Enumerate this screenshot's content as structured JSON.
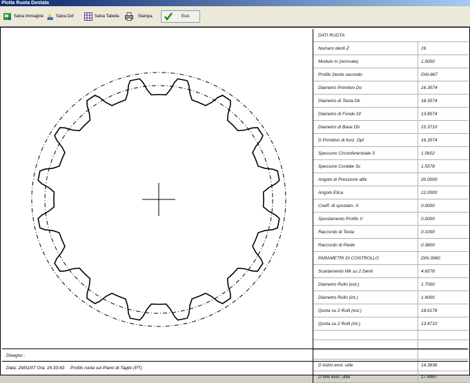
{
  "window": {
    "title": "Plotta Ruota Dentata"
  },
  "toolbar": {
    "buttons": [
      {
        "label": "Salva Immagine",
        "icon": "save-image-icon"
      },
      {
        "label": "Salva Dxf",
        "icon": "save-dxf-icon"
      },
      {
        "label": "Salva Tabella",
        "icon": "table-icon"
      },
      {
        "label": "Stampa",
        "icon": "printer-icon"
      },
      {
        "label": "Esci",
        "icon": "checkmark-icon"
      }
    ]
  },
  "gear": {
    "teeth": 16
  },
  "table": {
    "rows": [
      {
        "label": "DATI RUOTA",
        "value": ""
      },
      {
        "label": "Numero denti Z",
        "value": "16"
      },
      {
        "label": "Modulo m (normale)",
        "value": "1.0000"
      },
      {
        "label": "Profilo Dente secondo",
        "value": "DIN-867"
      },
      {
        "label": "Diametro Primitivo Do",
        "value": "16.3574"
      },
      {
        "label": "Diametro di Testa Dk",
        "value": "18.3574"
      },
      {
        "label": "Diametro di Fondo Df",
        "value": "13.8574"
      },
      {
        "label": "Diametro di Base Db",
        "value": "15.3710"
      },
      {
        "label": "D Primitivo di funz. Dpf",
        "value": "16.3574"
      },
      {
        "label": "Spessore Circonferenziale S",
        "value": "1.5602"
      },
      {
        "label": "Spessore Cordale Sc",
        "value": "1.5578"
      },
      {
        "label": "Angolo di Pressione alfa",
        "value": "20.0000"
      },
      {
        "label": "Angolo Elica",
        "value": "12.0000"
      },
      {
        "label": "Coeff. di spostam. X",
        "value": "0.0000"
      },
      {
        "label": "Spostamento Profilo V",
        "value": "0.0000"
      },
      {
        "label": "Raccordo di Testa",
        "value": "0.1000"
      },
      {
        "label": "Raccordo di Piede",
        "value": "0.3800"
      },
      {
        "label": "PARAMETRI DI CONTROLLO",
        "value": "DIN-3960"
      },
      {
        "label": "Scartamento Wk su 2 Denti",
        "value": "4.6576"
      },
      {
        "label": "Diametro Rullo (est.)",
        "value": "1.7000"
      },
      {
        "label": "Diametro Rullo (int.)",
        "value": "1.9000"
      },
      {
        "label": "Quota su 2 Rulli (est.)",
        "value": "18.6178"
      },
      {
        "label": "Quota su 2 Rulli (int.)",
        "value": "13.4710"
      },
      {
        "label": "",
        "value": ""
      },
      {
        "label": "",
        "value": ""
      },
      {
        "label": "",
        "value": ""
      },
      {
        "label": "D inizio evol. utile",
        "value": "14.3836"
      },
      {
        "label": "D fine evol. utile",
        "value": "17.4967"
      }
    ]
  },
  "footer": {
    "drawing_label": "Disegno :",
    "datetime": "Data: 29/01/07 Ora: 16:33:43",
    "profile": "Profilo ruota sul Piano di Taglio (PT)"
  }
}
